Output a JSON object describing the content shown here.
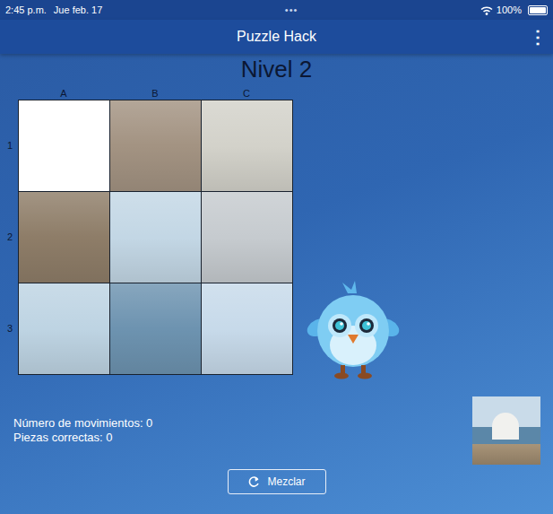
{
  "status_bar": {
    "time": "2:45 p.m.",
    "date": "Jue feb. 17",
    "dots": "•••",
    "battery": "100%",
    "battery_level": 1
  },
  "navbar": {
    "title": "Puzzle Hack",
    "menu": "⋮"
  },
  "level_title": "Nivel 2",
  "board": {
    "columns": [
      "A",
      "B",
      "C"
    ],
    "rows": [
      "1",
      "2",
      "3"
    ],
    "tiles": [
      [
        {
          "kind": "empty",
          "color": "#ffffff"
        },
        {
          "kind": "photo",
          "color": "#a39382"
        },
        {
          "kind": "photo",
          "color": "#d3d2ca"
        }
      ],
      [
        {
          "kind": "photo",
          "color": "#8e7d68"
        },
        {
          "kind": "photo",
          "color": "#c3d7e5"
        },
        {
          "kind": "photo",
          "color": "#c6cbcf"
        }
      ],
      [
        {
          "kind": "photo",
          "color": "#bed4e3"
        },
        {
          "kind": "photo",
          "color": "#6d93b0"
        },
        {
          "kind": "photo",
          "color": "#c7daea"
        }
      ]
    ]
  },
  "stats": [
    "Número de movimientos: 0",
    "Piezas correctas: 0"
  ],
  "shuffle_button": "Mezclar"
}
